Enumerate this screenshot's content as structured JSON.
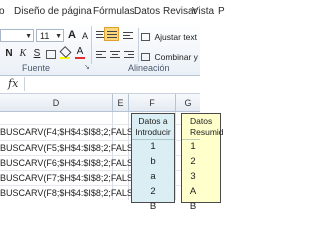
{
  "ribbon_tabs": [
    "o",
    "Diseño de página",
    "Fórmulas",
    "Datos",
    "Revisar",
    "Vista",
    "P"
  ],
  "font": {
    "name_value": "",
    "size_value": "11",
    "bold": "N",
    "italic": "K",
    "underline": "S",
    "grow": "A",
    "shrink": "A",
    "group_label": "Fuente"
  },
  "alignment": {
    "wrap_text": "Ajustar text",
    "merge_center": "Combinar y",
    "group_label": "Alineación"
  },
  "formula_bar": {
    "fx": "fx",
    "value": ""
  },
  "columns": [
    "D",
    "E",
    "F",
    "G"
  ],
  "formulas": [
    "BUSCARV(F4;$H$4:$I$8;2;FALSO)",
    "BUSCARV(F5;$H$4:$I$8;2;FALSO)",
    "BUSCARV(F6;$H$4:$I$8;2;FALSO)",
    "BUSCARV(F7;$H$4:$I$8;2;FALSO)",
    "BUSCARV(F8;$H$4:$I$8;2;FALSO)"
  ],
  "table_input": {
    "header_line1": "Datos a",
    "header_line2": "Introducir",
    "values": [
      "1",
      "b",
      "a",
      "2",
      "B"
    ],
    "fill": "#daeef3"
  },
  "table_summary": {
    "header_line1": "Datos",
    "header_line2": "Resumid",
    "values": [
      "1",
      "2",
      "3",
      "A",
      "B"
    ],
    "fill": "#ffffcc"
  }
}
